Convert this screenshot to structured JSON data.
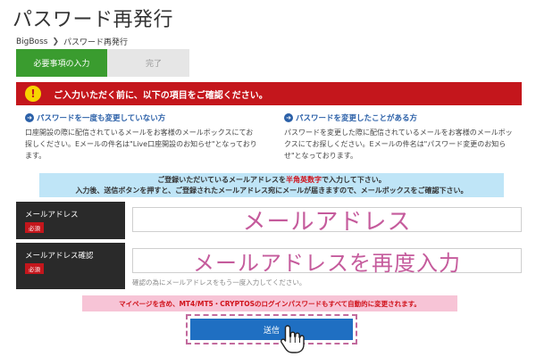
{
  "page": {
    "title": "パスワード再発行"
  },
  "breadcrumb": {
    "home": "BigBoss",
    "current": "パスワード再発行"
  },
  "steps": [
    {
      "label": "必要事項の入力",
      "active": true
    },
    {
      "label": "完了",
      "active": false
    }
  ],
  "alert": {
    "text": "ご入力いただく前に、以下の項目をご確認ください。",
    "color": "#c4161c"
  },
  "info": [
    {
      "heading": "パスワードを一度も変更していない方",
      "body": "口座開設の際に配信されているメールをお客様のメールボックスにてお探しください。Eメールの件名は\"Live口座開設のお知らせ\"となっております。"
    },
    {
      "heading": "パスワードを変更したことがある方",
      "body": "パスワードを変更した際に配信されているメールをお客様のメールボックスにてお探しください。Eメールの件名は\"パスワード変更のお知らせ\"となっております。"
    }
  ],
  "blue_notice": {
    "line1_before": "ご登録いただいているメールアドレスを",
    "line1_red": "半角英数字",
    "line1_after": "で入力して下さい。",
    "line2": "入力後、送信ボタンを押すと、ご登録されたメールアドレス宛にメールが届きますので、メールボックスをご確認下さい。"
  },
  "form": {
    "email": {
      "label": "メールアドレス",
      "badge": "必須",
      "value": "メールアドレス"
    },
    "email_confirm": {
      "label": "メールアドレス確認",
      "badge": "必須",
      "value": "メールアドレスを再度入力",
      "hint": "確認の為にメールアドレスをもう一度入力してください。"
    }
  },
  "pink_notice": {
    "text": "マイページを含め、MT4/MT5・CRYPTOSのログインパスワードもすべて自動的に変更されます。"
  },
  "submit": {
    "label": "送信"
  },
  "icons": {
    "alert": "exclamation-icon",
    "info_arrow": "circle-arrow-right-icon",
    "cursor": "hand-pointer-icon"
  },
  "colors": {
    "step_active": "#3a9c2f",
    "button": "#1f6fc2",
    "notice_blue": "#bfe5f7",
    "notice_pink": "#f7c4d6",
    "input_text": "#c55b9c"
  }
}
